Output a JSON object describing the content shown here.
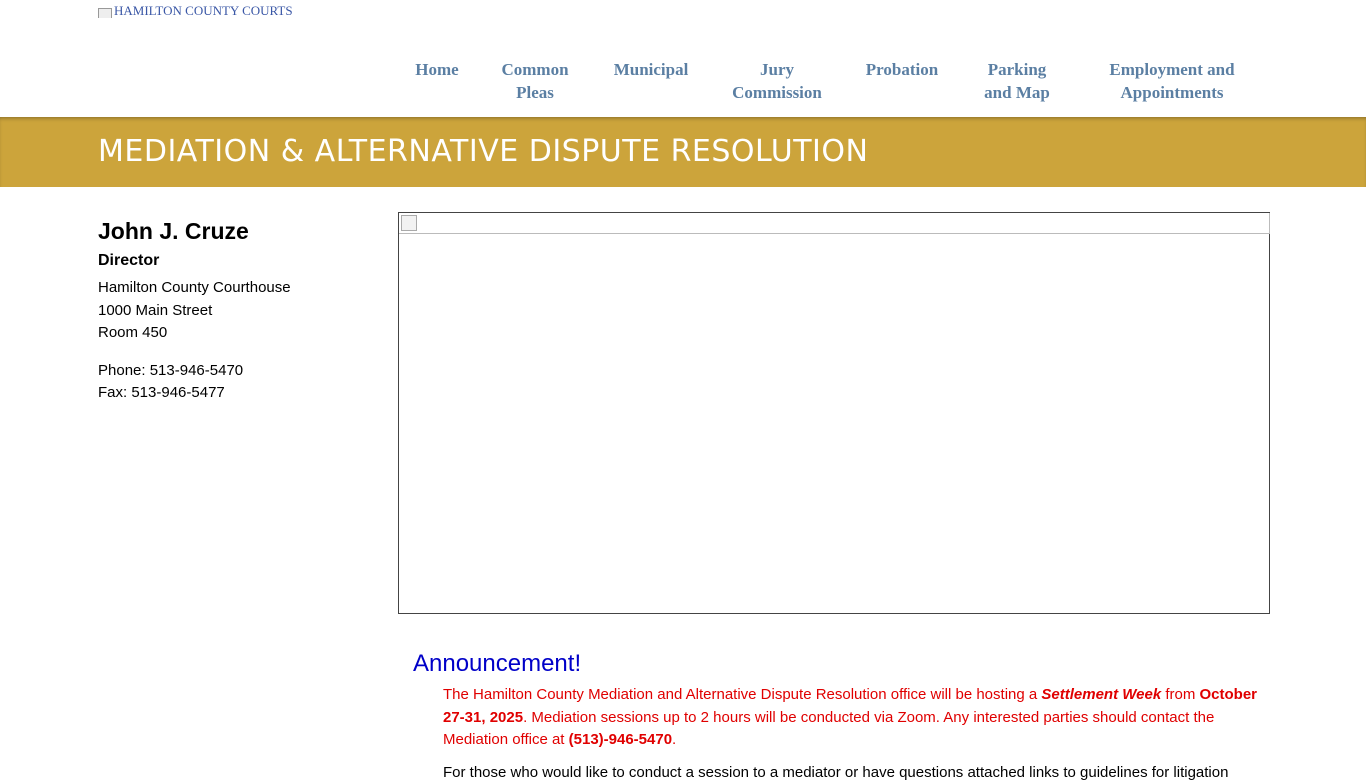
{
  "header": {
    "logo_alt": "HAMILTON COUNTY COURTS"
  },
  "nav": [
    {
      "label": "Home"
    },
    {
      "label": "Common\nPleas"
    },
    {
      "label": "Municipal"
    },
    {
      "label": "Jury\nCommission"
    },
    {
      "label": "Probation"
    },
    {
      "label": "Parking\nand Map"
    },
    {
      "label": "Employment and\nAppointments"
    }
  ],
  "banner": {
    "title": "MEDIATION & ALTERNATIVE DISPUTE RESOLUTION"
  },
  "sidebar": {
    "name": "John J. Cruze",
    "role": "Director",
    "address": [
      "Hamilton County Courthouse",
      "1000 Main Street",
      "Room 450"
    ],
    "phone": "Phone: 513-946-5470",
    "fax": "Fax: 513-946-5477"
  },
  "announcement": {
    "heading": "Announcement!",
    "text_1": "The Hamilton County Mediation and Alternative Dispute Resolution office will be hosting a ",
    "event": "Settlement Week",
    "text_2": " from ",
    "dates": "October 27-31, 2025",
    "text_3": ". Mediation sessions up to 2 hours will be conducted via Zoom. Any interested parties should contact the Mediation office at ",
    "phone": "(513)-946-5470",
    "text_4": ".",
    "next_line": "For those who would like to conduct a session to a mediator or have questions attached links to guidelines for litigation"
  },
  "colors": {
    "banner": "#cca43b",
    "nav_text": "#5b7fa3",
    "announcement_heading": "#0000c8",
    "announcement_text": "#e00000"
  }
}
